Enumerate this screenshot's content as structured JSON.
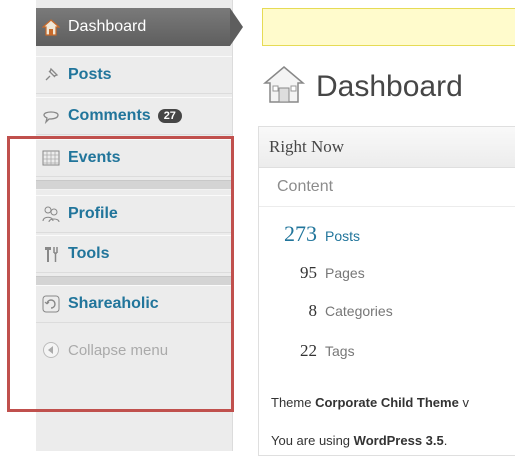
{
  "sidebar": {
    "active": {
      "label": "Dashboard",
      "icon": "house-icon"
    },
    "items": [
      {
        "label": "Posts",
        "icon": "pushpin-icon"
      },
      {
        "label": "Comments",
        "icon": "speech-bubble-icon",
        "badge": "27"
      },
      {
        "label": "Events",
        "icon": "calendar-grid-icon"
      },
      {
        "label": "Profile",
        "icon": "users-icon"
      },
      {
        "label": "Tools",
        "icon": "tools-icon"
      },
      {
        "label": "Shareaholic",
        "icon": "shareaholic-icon"
      }
    ],
    "collapse": {
      "label": "Collapse menu",
      "icon": "collapse-arrow-icon"
    }
  },
  "main": {
    "title": "Dashboard",
    "panel": {
      "heading": "Right Now",
      "subheading": "Content",
      "rows": [
        {
          "count": "273",
          "label": "Posts"
        },
        {
          "count": "95",
          "label": "Pages"
        },
        {
          "count": "8",
          "label": "Categories"
        },
        {
          "count": "22",
          "label": "Tags"
        }
      ],
      "theme_prefix": "Theme",
      "theme_name": "Corporate Child Theme",
      "theme_suffix": "v",
      "version_prefix": "You are using",
      "version_name": "WordPress 3.5",
      "version_suffix": "."
    }
  },
  "colors": {
    "link": "#21759b",
    "highlight": "#c0504d",
    "notice": "#fffbcc"
  }
}
